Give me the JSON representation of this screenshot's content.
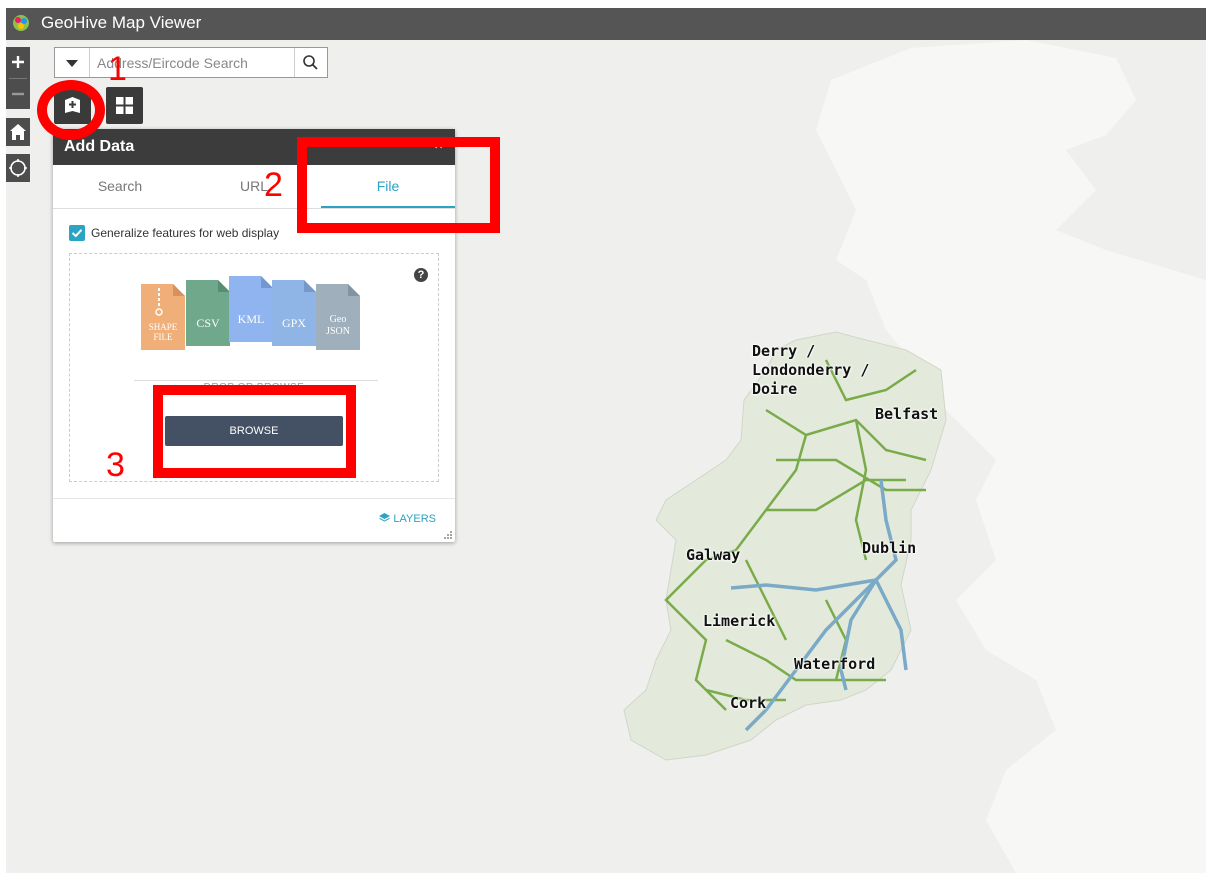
{
  "app": {
    "title": "GeoHive Map Viewer"
  },
  "search": {
    "placeholder": "Address/Eircode Search",
    "value": ""
  },
  "panel": {
    "title": "Add Data",
    "close_label": "×",
    "tabs": [
      {
        "label": "Search",
        "active": false
      },
      {
        "label": "URL",
        "active": false
      },
      {
        "label": "File",
        "active": true
      }
    ],
    "generalize_label": "Generalize features for web display",
    "generalize_checked": true,
    "help_label": "?",
    "file_types": [
      {
        "line1": "SHAPE",
        "line2": "FILE",
        "color": "#f0ae78"
      },
      {
        "line1": "CSV",
        "line2": "",
        "color": "#6fa88a"
      },
      {
        "line1": "KML",
        "line2": "",
        "color": "#8fb4f0"
      },
      {
        "line1": "GPX",
        "line2": "",
        "color": "#8fb4e6"
      },
      {
        "line1": "Geo",
        "line2": "JSON",
        "color": "#9fb0bc"
      }
    ],
    "drop_text": "DROP OR BROWSE",
    "browse_label": "BROWSE",
    "layers_label": "LAYERS"
  },
  "annotations": {
    "step1": "1",
    "step2": "2",
    "step3": "3",
    "color": "#ff0000"
  },
  "map": {
    "cities": {
      "derry": "Derry /\nLondonderry /\nDoire",
      "belfast": "Belfast",
      "galway": "Galway",
      "dublin": "Dublin",
      "limerick": "Limerick",
      "waterford": "Waterford",
      "cork": "Cork"
    },
    "road_colors": {
      "green": "#7aab4a",
      "blue": "#7aaac8"
    }
  }
}
